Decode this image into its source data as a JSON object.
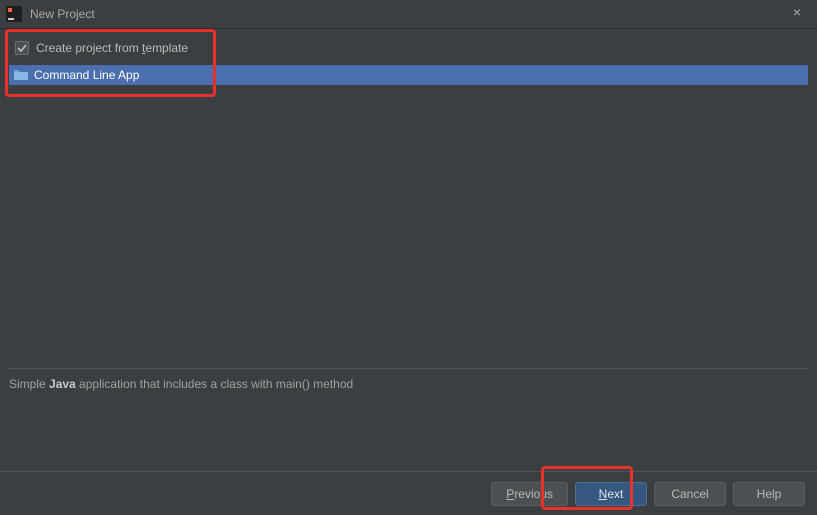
{
  "title": "New Project",
  "checkbox": {
    "label_pre": "Create project from ",
    "mnemonic": "t",
    "label_post": "emplate",
    "checked": true
  },
  "templates": [
    {
      "label": "Command Line App"
    }
  ],
  "description": {
    "pre": "Simple ",
    "bold": "Java",
    "post": " application that includes a class with main() method"
  },
  "buttons": {
    "previous_pre": "",
    "previous_mn": "P",
    "previous_post": "revious",
    "next_pre": "",
    "next_mn": "N",
    "next_post": "ext",
    "cancel": "Cancel",
    "help": "Help"
  }
}
